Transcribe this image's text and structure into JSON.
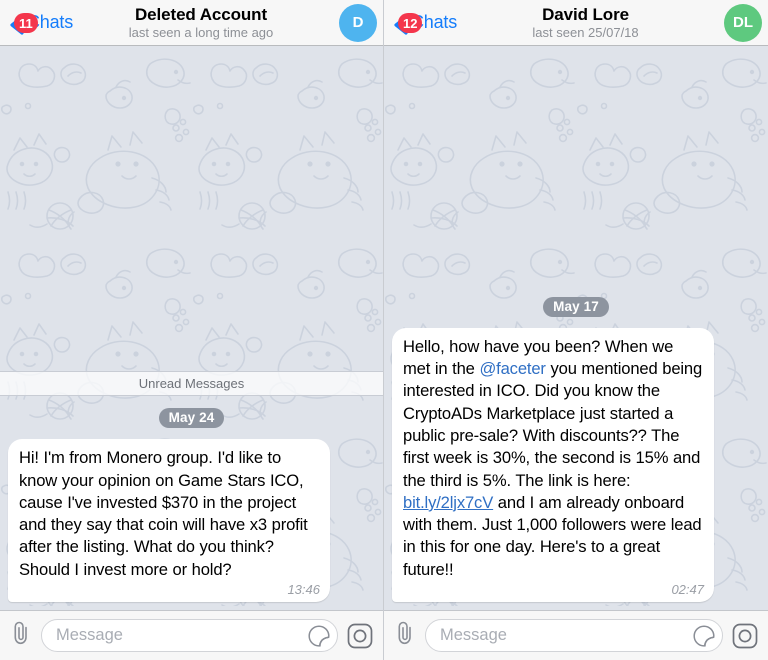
{
  "panels": [
    {
      "header": {
        "back_label": "Chats",
        "badge": "11",
        "title": "Deleted Account",
        "subtitle": "last seen a long time ago",
        "avatar_initials": "D",
        "avatar_color": "#4eb4ef"
      },
      "chat": {
        "unread_divider": "Unread Messages",
        "date_pill": "May 24",
        "message": {
          "text_before_link": "Hi! I'm from Monero group. I'd like to know your opinion on Game Stars ICO, cause I've invested $370 in the project and they say that coin will have x3 profit after the listing. What do you think? Should I invest more or hold?",
          "time": "13:46"
        }
      },
      "input": {
        "placeholder": "Message",
        "value": "",
        "attach_icon": "paperclip-icon",
        "sticker_icon": "sticker-icon",
        "camera_icon": "camera-icon"
      }
    },
    {
      "header": {
        "back_label": "Chats",
        "badge": "12",
        "title": "David Lore",
        "subtitle": "last seen 25/07/18",
        "avatar_initials": "DL",
        "avatar_color": "#5ec97f"
      },
      "chat": {
        "date_pill": "May 17",
        "message": {
          "part1": "Hello, how have you been? When we met in the ",
          "mention": "@faceter",
          "part2": " you mentioned being interested in ICO. Did you know the CryptoADs Marketplace just started a public pre-sale? With discounts?? The first week is 30%, the second is 15% and the third is 5%. The link is here: ",
          "link": "bit.ly/2ljx7cV",
          "part3": " and I am already onboard with them. Just 1,000 followers were lead in this for one day. Here's to a great future!!",
          "time": "02:47"
        }
      },
      "input": {
        "placeholder": "Message",
        "value": "",
        "attach_icon": "paperclip-icon",
        "sticker_icon": "sticker-icon",
        "camera_icon": "camera-icon"
      }
    }
  ],
  "colors": {
    "accent_blue": "#157dfb",
    "badge_red": "#f4364c",
    "chat_bg": "#dfe3ea",
    "bubble_bg": "#ffffff",
    "link_blue": "#2f6fc4"
  }
}
